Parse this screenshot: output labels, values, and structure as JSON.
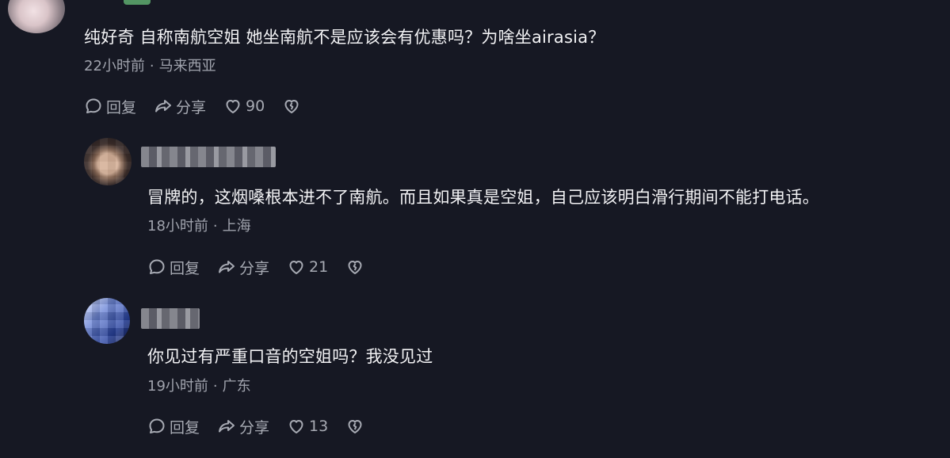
{
  "comments": [
    {
      "text": "纯好奇 自称南航空姐 她坐南航不是应该会有优惠吗？为啥坐airasia？",
      "time": "22小时前",
      "location": "马来西亚",
      "actions": {
        "reply": "回复",
        "share": "分享",
        "likes": "90"
      }
    },
    {
      "text": "冒牌的，这烟嗓根本进不了南航。而且如果真是空姐，自己应该明白滑行期间不能打电话。",
      "time": "18小时前",
      "location": "上海",
      "actions": {
        "reply": "回复",
        "share": "分享",
        "likes": "21"
      }
    },
    {
      "text": "你见过有严重口音的空姐吗？我没见过",
      "time": "19小时前",
      "location": "广东",
      "actions": {
        "reply": "回复",
        "share": "分享",
        "likes": "13"
      }
    }
  ],
  "icons": {
    "reply": "comment-bubble-icon",
    "share": "share-arrow-icon",
    "like": "heart-icon",
    "dislike": "broken-heart-icon"
  },
  "colors": {
    "background": "#161823",
    "text": "#f2f2f4",
    "meta": "#a0a3ad",
    "action": "#a7aab3"
  }
}
